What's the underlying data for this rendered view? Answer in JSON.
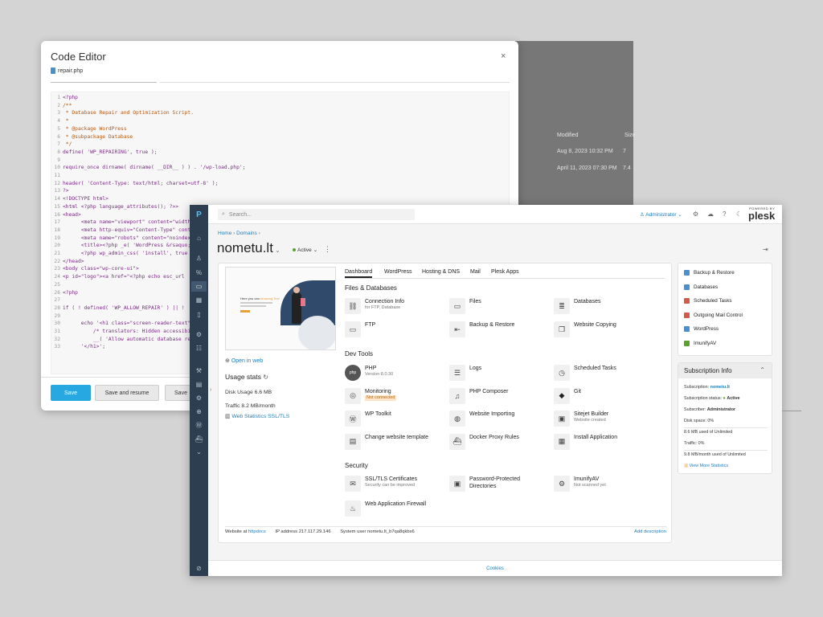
{
  "background_window": {
    "col_modified": "Modified",
    "col_size": "Size",
    "rows": [
      {
        "modified": "Aug 8, 2023 10:32 PM",
        "size": "7"
      },
      {
        "modified": "April 11, 2023 07:30 PM",
        "size": "7.4"
      }
    ]
  },
  "code_editor": {
    "title": "Code Editor",
    "close": "×",
    "file_tab": "repair.php",
    "lines": [
      "<?php",
      "/**",
      " * Database Repair and Optimization Script.",
      " *",
      " * @package WordPress",
      " * @subpackage Database",
      " */",
      "define( 'WP_REPAIRING', true );",
      "",
      "require_once dirname( dirname( __DIR__ ) ) . '/wp-load.php';",
      "",
      "header( 'Content-Type: text/html; charset=utf-8' );",
      "?>",
      "<!DOCTYPE html>",
      "<html <?php language_attributes(); ?>>",
      "<head>",
      "      <meta name=\"viewport\" content=\"width",
      "      <meta http-equiv=\"Content-Type\" cont",
      "      <meta name=\"robots\" content=\"noindex",
      "      <title><?php _e( 'WordPress &rsaquo;",
      "      <?php wp_admin_css( 'install', true",
      "</head>",
      "<body class=\"wp-core-ui\">",
      "<p id=\"logo\"><a href=\"<?php echo esc_url",
      "",
      "<?php",
      "",
      "if ( ! defined( 'WP_ALLOW_REPAIR' ) || !",
      "",
      "      echo '<h1 class=\"screen-reader-text\"",
      "          /* translators: Hidden accessibil",
      "          __( 'Allow automatic database re",
      "      '</h1>';"
    ],
    "save": "Save",
    "save_resume": "Save and resume",
    "save_partial": "Save"
  },
  "plesk": {
    "search_placeholder": "Search...",
    "admin": "Administrator",
    "powered_by": "POWERED BY",
    "brand": "plesk",
    "breadcrumb": [
      "Home",
      "Domains"
    ],
    "domain": "nometu.lt",
    "status": "Active",
    "open_in_web": "Open in web",
    "usage_title": "Usage stats",
    "disk_usage_label": "Disk Usage",
    "disk_usage_value": "6.6 MB",
    "traffic_label": "Traffic",
    "traffic_value": "8.2 MB/month",
    "web_stats": "Web Statistics SSL/TLS",
    "tabs": [
      "Dashboard",
      "WordPress",
      "Hosting & DNS",
      "Mail",
      "Plesk Apps"
    ],
    "section_files": "Files & Databases",
    "section_dev": "Dev Tools",
    "section_security": "Security",
    "files": [
      {
        "label": "Connection Info",
        "sub": "for FTP, Database",
        "icon": "connection-info-icon"
      },
      {
        "label": "Files",
        "sub": "",
        "icon": "folder-icon"
      },
      {
        "label": "Databases",
        "sub": "",
        "icon": "database-icon"
      },
      {
        "label": "FTP",
        "sub": "",
        "icon": "ftp-icon"
      },
      {
        "label": "Backup & Restore",
        "sub": "",
        "icon": "backup-icon"
      },
      {
        "label": "Website Copying",
        "sub": "",
        "icon": "copy-icon"
      }
    ],
    "dev": [
      {
        "label": "PHP",
        "sub": "Version 8.0.30",
        "icon": "php-icon"
      },
      {
        "label": "Logs",
        "sub": "",
        "icon": "logs-icon"
      },
      {
        "label": "Scheduled Tasks",
        "sub": "",
        "icon": "clock-icon"
      },
      {
        "label": "Monitoring",
        "sub": "Not connected",
        "icon": "monitoring-icon"
      },
      {
        "label": "PHP Composer",
        "sub": "",
        "icon": "composer-icon"
      },
      {
        "label": "Git",
        "sub": "",
        "icon": "git-icon"
      },
      {
        "label": "WP Toolkit",
        "sub": "",
        "icon": "wordpress-icon"
      },
      {
        "label": "Website Importing",
        "sub": "",
        "icon": "globe-icon"
      },
      {
        "label": "Sitejet Builder",
        "sub": "Website created",
        "icon": "sitejet-icon"
      },
      {
        "label": "Change website template",
        "sub": "",
        "icon": "template-icon"
      },
      {
        "label": "Docker Proxy Rules",
        "sub": "",
        "icon": "docker-icon"
      },
      {
        "label": "Install Application",
        "sub": "",
        "icon": "apps-icon"
      }
    ],
    "security": [
      {
        "label": "SSL/TLS Certificates",
        "sub": "Security can be improved",
        "icon": "certificate-icon"
      },
      {
        "label": "Password-Protected Directories",
        "sub": "",
        "icon": "lock-folder-icon"
      },
      {
        "label": "ImunifyAV",
        "sub": "Not scanned yet",
        "icon": "shield-icon"
      },
      {
        "label": "Web Application Firewall",
        "sub": "",
        "icon": "firewall-icon"
      }
    ],
    "footer_website_at": "Website at",
    "footer_httpdocs": "httpdocs",
    "footer_ip_label": "IP address",
    "footer_ip": "217.117.29.146",
    "footer_sysuser_label": "System user",
    "footer_sysuser": "nometu.lt_b7qa8qkbs6",
    "add_description": "Add description",
    "quick_links": [
      "Backup & Restore",
      "Databases",
      "Scheduled Tasks",
      "Outgoing Mail Control",
      "WordPress",
      "ImunifyAV"
    ],
    "sub_info_title": "Subscription Info",
    "sub_subscription_label": "Subscription:",
    "sub_subscription": "nometu.lt",
    "sub_status_label": "Subscription status:",
    "sub_status": "Active",
    "sub_subscriber_label": "Subscriber:",
    "sub_subscriber": "Administrator",
    "sub_disk": "Disk space: 0%",
    "sub_disk_used": "8.6 MB used of Unlimited",
    "sub_traffic": "Traffic: 0%",
    "sub_traffic_used": "9.8 MB/month used of Unlimited",
    "sub_more_stats": "View More Statistics",
    "cookies": "Cookies",
    "preview_headline": "Here you can",
    "preview_highlight": "Amazing Text"
  }
}
